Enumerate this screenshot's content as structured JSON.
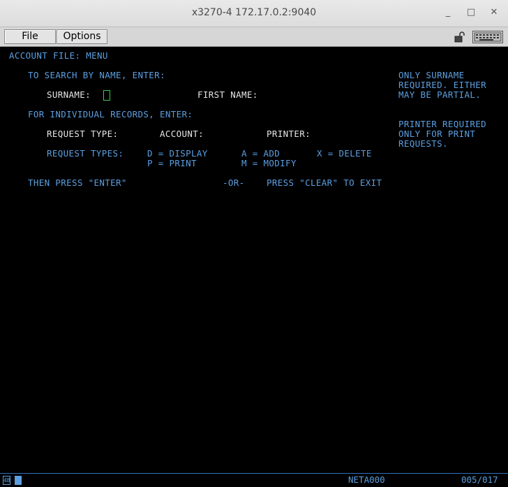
{
  "window": {
    "title": "x3270-4 172.17.0.2:9040",
    "minimize": "_",
    "maximize": "□",
    "close": "✕"
  },
  "menubar": {
    "file": "File",
    "options": "Options"
  },
  "screen": {
    "header": "ACCOUNT FILE: MENU",
    "search_prompt": "TO SEARCH BY NAME, ENTER:",
    "surname_label": "SURNAME:",
    "first_name_label": "FIRST NAME:",
    "hint1": [
      "ONLY SURNAME",
      "REQUIRED. EITHER",
      "MAY BE PARTIAL."
    ],
    "records_prompt": "FOR INDIVIDUAL RECORDS, ENTER:",
    "request_type_label": "REQUEST TYPE:",
    "account_label": "ACCOUNT:",
    "printer_label": "PRINTER:",
    "hint2": [
      "PRINTER REQUIRED",
      "ONLY FOR PRINT",
      "REQUESTS."
    ],
    "request_types_label": "REQUEST TYPES:",
    "type_display": "D = DISPLAY",
    "type_print": "P = PRINT",
    "type_add": "A = ADD",
    "type_modify": "M = MODIFY",
    "type_delete": "X = DELETE",
    "then_press": "THEN PRESS \"ENTER\"",
    "or": "-OR-",
    "press_clear": "PRESS \"CLEAR\" TO EXIT"
  },
  "status": {
    "indicator": "4B",
    "lu_name": "NETA000",
    "cursor_pos": "005/017"
  },
  "colors": {
    "protected_text": "#5b9fe0",
    "label_text": "#e6e6e6",
    "input_cursor": "#34d34a",
    "background": "#000000"
  }
}
